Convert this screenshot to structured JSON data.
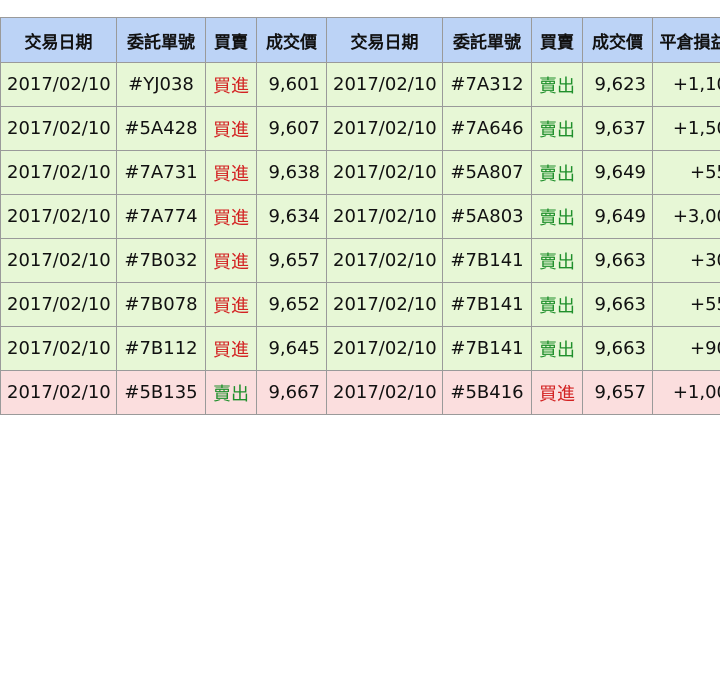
{
  "table": {
    "headers": [
      "交易日期",
      "委託單號",
      "買賣",
      "成交價",
      "交易日期",
      "委託單號",
      "買賣",
      "成交價",
      "平倉損益"
    ],
    "rows": [
      {
        "result": "win",
        "cells": [
          "2017/02/10",
          "#YJ038",
          "買進",
          "9,601",
          "2017/02/10",
          "#7A312",
          "賣出",
          "9,623",
          "+1,10"
        ]
      },
      {
        "result": "win",
        "cells": [
          "2017/02/10",
          "#5A428",
          "買進",
          "9,607",
          "2017/02/10",
          "#7A646",
          "賣出",
          "9,637",
          "+1,50"
        ]
      },
      {
        "result": "win",
        "cells": [
          "2017/02/10",
          "#7A731",
          "買進",
          "9,638",
          "2017/02/10",
          "#5A807",
          "賣出",
          "9,649",
          "+55"
        ]
      },
      {
        "result": "win",
        "cells": [
          "2017/02/10",
          "#7A774",
          "買進",
          "9,634",
          "2017/02/10",
          "#5A803",
          "賣出",
          "9,649",
          "+3,00"
        ]
      },
      {
        "result": "win",
        "cells": [
          "2017/02/10",
          "#7B032",
          "買進",
          "9,657",
          "2017/02/10",
          "#7B141",
          "賣出",
          "9,663",
          "+30"
        ]
      },
      {
        "result": "win",
        "cells": [
          "2017/02/10",
          "#7B078",
          "買進",
          "9,652",
          "2017/02/10",
          "#7B141",
          "賣出",
          "9,663",
          "+55"
        ]
      },
      {
        "result": "win",
        "cells": [
          "2017/02/10",
          "#7B112",
          "買進",
          "9,645",
          "2017/02/10",
          "#7B141",
          "賣出",
          "9,663",
          "+90"
        ]
      },
      {
        "result": "loss",
        "cells": [
          "2017/02/10",
          "#5B135",
          "賣出",
          "9,667",
          "2017/02/10",
          "#5B416",
          "買進",
          "9,657",
          "+1,00"
        ]
      }
    ]
  },
  "colors": {
    "header_bg": "#bcd3f6",
    "win_row_bg": "#e7f7d6",
    "loss_row_bg": "#fbdede",
    "buy_text": "#d32222",
    "sell_text": "#1f8f2b"
  }
}
